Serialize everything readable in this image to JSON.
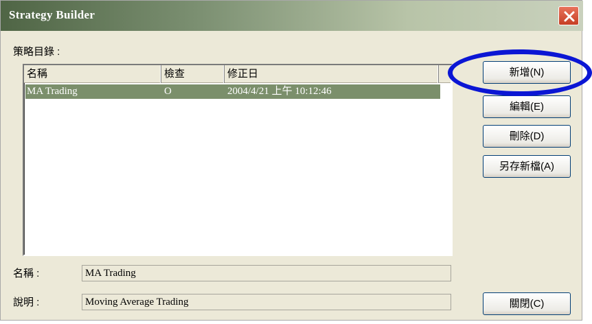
{
  "window": {
    "title": "Strategy Builder"
  },
  "strategy_list": {
    "label": "策略目錄 :",
    "columns": [
      "名稱",
      "檢查",
      "修正日"
    ],
    "rows": [
      {
        "name": "MA Trading",
        "check": "O",
        "modified": "2004/4/21 上午 10:12:46",
        "selected": true
      }
    ]
  },
  "details": {
    "name_label": "名稱 :",
    "name_value": "MA Trading",
    "desc_label": "說明 :",
    "desc_value": "Moving Average Trading"
  },
  "buttons": {
    "add": "新增(N)",
    "edit": "編輯(E)",
    "delete": "刪除(D)",
    "save_as": "另存新檔(A)",
    "close": "關閉(C)"
  },
  "colors": {
    "selection": "#7b8f6b",
    "annotation": "#0b16d4",
    "close_button": "#c63f25"
  },
  "icons": {
    "close": "close-icon"
  }
}
